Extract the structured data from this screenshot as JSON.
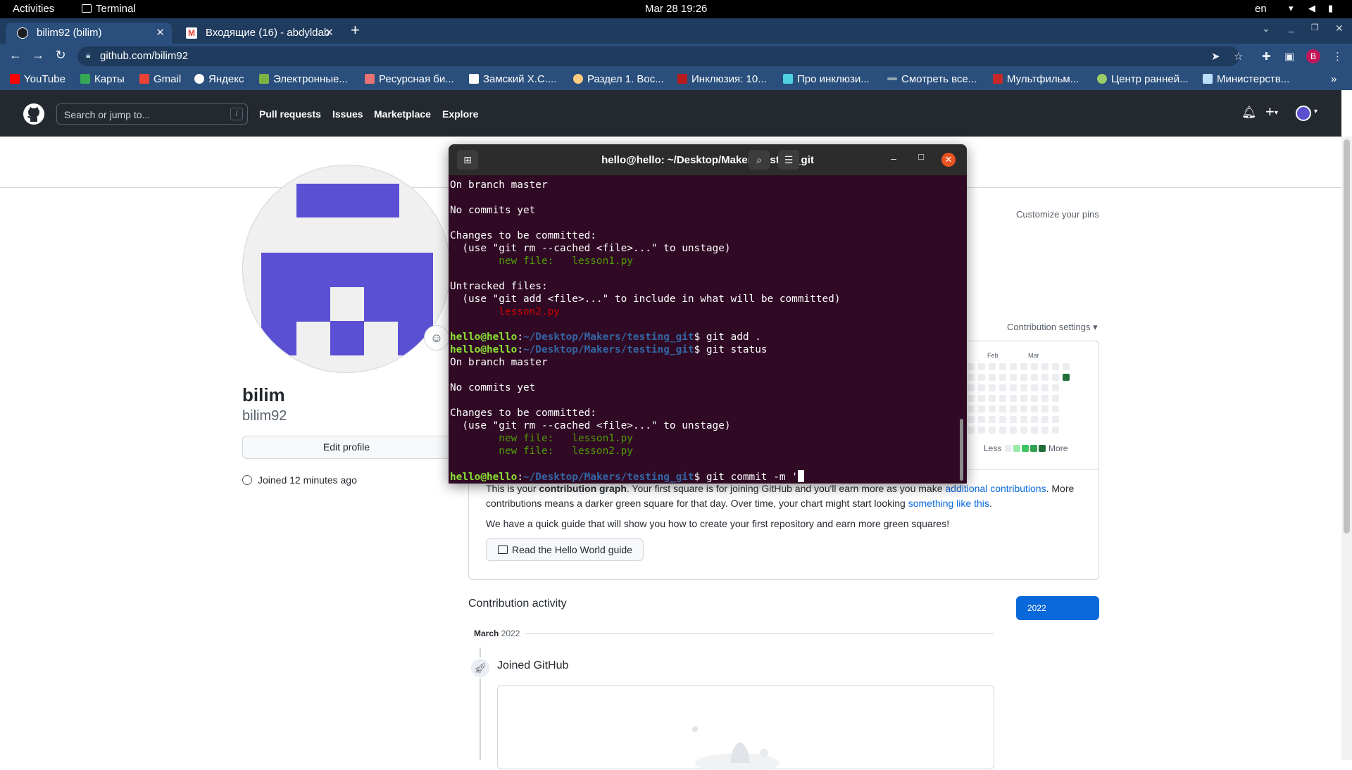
{
  "gnome_bar": {
    "activities": "Activities",
    "app": "Terminal",
    "clock": "Mar 28  19:26",
    "lang": "en"
  },
  "browser": {
    "tabs": [
      {
        "label": "bilim92 (bilim)",
        "active": true
      },
      {
        "label": "Входящие (16) - abdyldab",
        "active": false
      }
    ],
    "url": "github.com/bilim92",
    "profile_initial": "B",
    "bookmarks": [
      {
        "label": "YouTube",
        "color": "#ff0000"
      },
      {
        "label": "Карты",
        "color": "#34a853"
      },
      {
        "label": "Gmail",
        "color": "#ea4335"
      },
      {
        "label": "Яндекс",
        "color": "#ffffff"
      },
      {
        "label": "Электронные...",
        "color": "#7cb342"
      },
      {
        "label": "Ресурсная би...",
        "color": "#e57373"
      },
      {
        "label": "Замский Х.С....",
        "color": "#ffffff"
      },
      {
        "label": "Раздел 1. Вос...",
        "color": "#ffcc80"
      },
      {
        "label": "Инклюзия: 10...",
        "color": "#b71c1c"
      },
      {
        "label": "Про инклюзи...",
        "color": "#4dd0e1"
      },
      {
        "label": "Смотреть все...",
        "color": "#90a4ae"
      },
      {
        "label": "Мультфильм...",
        "color": "#c62828"
      },
      {
        "label": "Центр ранней...",
        "color": "#9ccc65"
      },
      {
        "label": "Министерств...",
        "color": "#bbdefb"
      }
    ]
  },
  "github": {
    "search_placeholder": "Search or jump to...",
    "search_key": "/",
    "nav": [
      "Pull requests",
      "Issues",
      "Marketplace",
      "Explore"
    ],
    "profile": {
      "name": "bilim",
      "login": "bilim92",
      "edit_label": "Edit profile",
      "joined": "Joined 12 minutes ago"
    },
    "customize_pins": "Customize your pins",
    "contribution_settings": "Contribution settings ▾",
    "graph": {
      "months": [
        "Feb",
        "Mar"
      ],
      "legend_less": "Less",
      "legend_more": "More",
      "legend_colors": [
        "#ebedf0",
        "#9be9a8",
        "#40c463",
        "#30a14e",
        "#216e39"
      ],
      "active_color": "#216e39"
    },
    "explain": {
      "p1": "This is your ",
      "bold": "contribution graph",
      "p2": ". Your first square is for joining GitHub and you'll earn more as you make ",
      "link1": "additional contributions",
      "p3": ". More contributions means a darker green square for that day. Over time, your chart might start looking ",
      "link2": "something like this",
      "p4": "."
    },
    "quick_guide": "We have a quick guide that will show you how to create your first repository and earn more green squares!",
    "hello_world_button": "Read the Hello World guide",
    "activity_title": "Contribution activity",
    "year": "2022",
    "month": "March",
    "month_year": "2022",
    "joined_event": "Joined GitHub"
  },
  "terminal": {
    "title": "hello@hello: ~/Desktop/Makers/testing_git",
    "prompt_user": "hello@hello",
    "prompt_path": "~/Desktop/Makers/testing_git",
    "lines": {
      "l1": "On branch master",
      "l3": "No commits yet",
      "l5": "Changes to be committed:",
      "l6": "  (use \"git rm --cached <file>...\" to unstage)",
      "l7": "        new file:   lesson1.py",
      "l9": "Untracked files:",
      "l10": "  (use \"git add <file>...\" to include in what will be committed)",
      "l11": "        lesson2.py",
      "cmd1": "$ git add .",
      "cmd2": "$ git status",
      "l14": "On branch master",
      "l16": "No commits yet",
      "l18": "Changes to be committed:",
      "l19": "  (use \"git rm --cached <file>...\" to unstage)",
      "l20": "        new file:   lesson1.py",
      "l21": "        new file:   lesson2.py",
      "cmd3": "$ git commit -m '"
    }
  }
}
